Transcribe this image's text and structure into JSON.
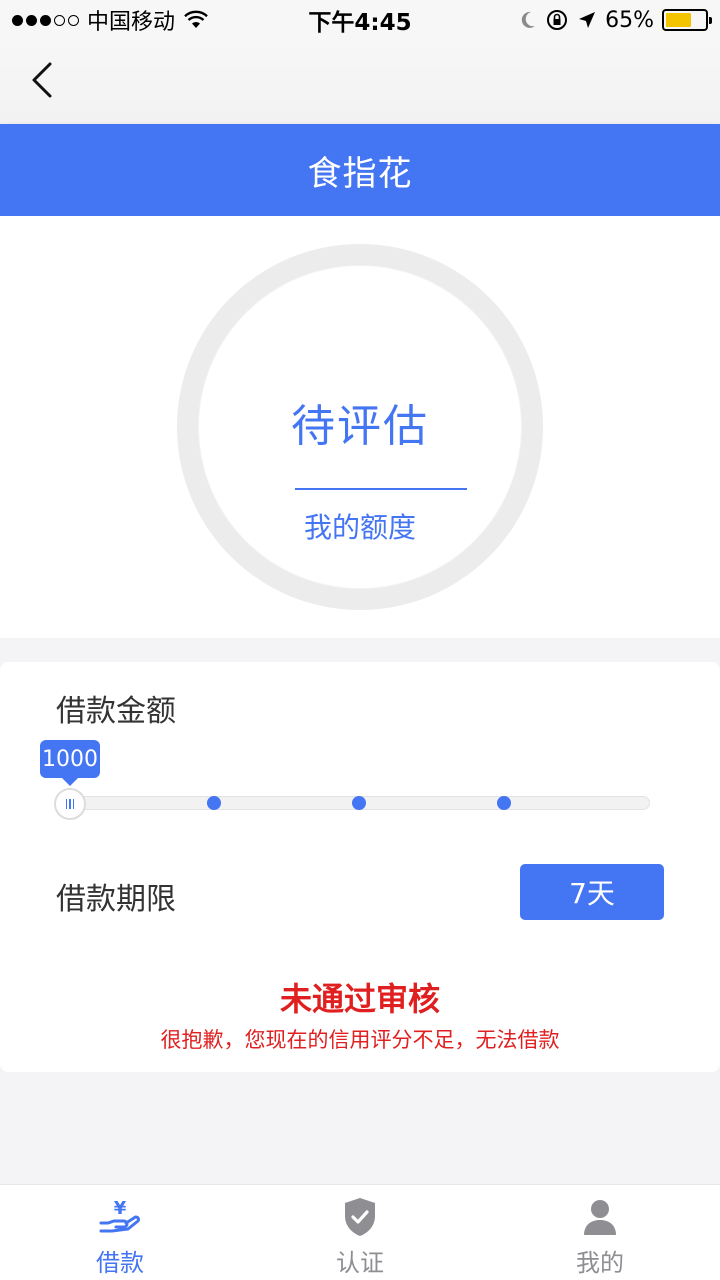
{
  "status_bar": {
    "carrier": "中国移动",
    "time": "下午4:45",
    "battery_text": "65%",
    "battery_level": 0.65,
    "signal_filled": 3,
    "signal_total": 5
  },
  "header": {
    "title": "食指花"
  },
  "gauge": {
    "status": "待评估",
    "label": "我的额度"
  },
  "loan": {
    "amount_label": "借款金额",
    "amount_value": "1000",
    "term_label": "借款期限",
    "term_value": "7天"
  },
  "result": {
    "title": "未通过审核",
    "message": "很抱歉，您现在的信用评分不足，无法借款"
  },
  "tabs": [
    {
      "label": "借款",
      "icon": "yen-hand-icon",
      "active": true
    },
    {
      "label": "认证",
      "icon": "shield-check-icon",
      "active": false
    },
    {
      "label": "我的",
      "icon": "user-icon",
      "active": false
    }
  ],
  "colors": {
    "accent": "#4475f2",
    "error": "#e02020",
    "tab_inactive": "#8e8e93"
  }
}
